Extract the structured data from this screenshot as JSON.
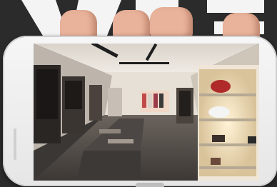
{
  "scene": {
    "description_labels": [],
    "colors": {
      "background": "#2b2b2b",
      "phone_body": "#f1f1f1",
      "skin": "#e9b29a",
      "floor": "#5b5550",
      "ceiling": "#e8e2da",
      "warm_light": "#f3d8a0"
    }
  }
}
